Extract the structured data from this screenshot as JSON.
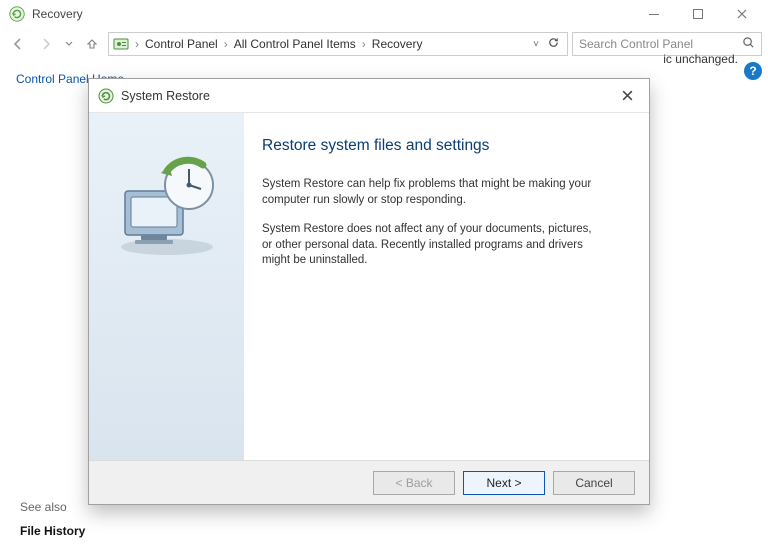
{
  "window": {
    "title": "Recovery",
    "min_label": "Minimize",
    "max_label": "Maximize",
    "close_label": "Close"
  },
  "nav": {
    "back_label": "Back",
    "forward_label": "Forward",
    "up_label": "Up",
    "crumbs": [
      "Control Panel",
      "All Control Panel Items",
      "Recovery"
    ],
    "refresh_label": "Refresh"
  },
  "search": {
    "placeholder": "Search Control Panel"
  },
  "body": {
    "home_link": "Control Panel Home",
    "bg_fragment": "ic unchanged.",
    "see_also": "See also",
    "file_history": "File History",
    "help_label": "?"
  },
  "dialog": {
    "title": "System Restore",
    "close_label": "Close",
    "heading": "Restore system files and settings",
    "para1": "System Restore can help fix problems that might be making your computer run slowly or stop responding.",
    "para2": "System Restore does not affect any of your documents, pictures, or other personal data. Recently installed programs and drivers might be uninstalled.",
    "back": "< Back",
    "next": "Next >",
    "cancel": "Cancel"
  }
}
